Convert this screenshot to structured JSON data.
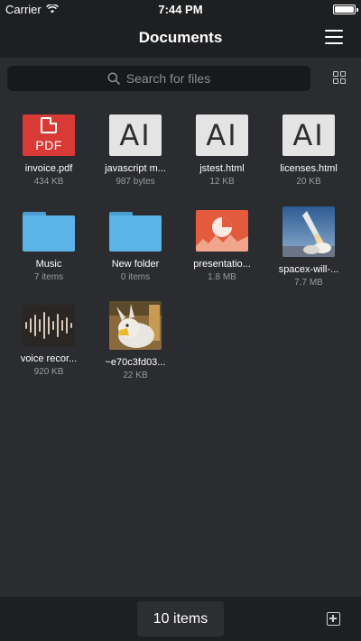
{
  "status": {
    "carrier": "Carrier",
    "time": "7:44 PM"
  },
  "nav": {
    "title": "Documents",
    "menu_icon": "hamburger-icon"
  },
  "search": {
    "placeholder": "Search for files",
    "view_icon": "grid-view-icon"
  },
  "files": [
    {
      "name": "invoice.pdf",
      "meta": "434 KB",
      "kind": "pdf",
      "badge": "PDF"
    },
    {
      "name": "javascript m...",
      "meta": "987 bytes",
      "kind": "ai",
      "badge": "AI"
    },
    {
      "name": "jstest.html",
      "meta": "12 KB",
      "kind": "ai",
      "badge": "AI"
    },
    {
      "name": "licenses.html",
      "meta": "20 KB",
      "kind": "ai",
      "badge": "AI"
    },
    {
      "name": "Music",
      "meta": "7 items",
      "kind": "folder"
    },
    {
      "name": "New folder",
      "meta": "0 items",
      "kind": "folder"
    },
    {
      "name": "presentatio...",
      "meta": "1.8 MB",
      "kind": "presentation"
    },
    {
      "name": "spacex-will-...",
      "meta": "7.7 MB",
      "kind": "photo-rocket"
    },
    {
      "name": "voice recor...",
      "meta": "920 KB",
      "kind": "audio"
    },
    {
      "name": "~e70c3fd03...",
      "meta": "22 KB",
      "kind": "photo-bunny"
    }
  ],
  "footer": {
    "count": "10 items",
    "add_icon": "add-file-icon"
  },
  "colors": {
    "background": "#2b2c2f",
    "bar": "#1e1f21",
    "pdf": "#d83a36",
    "folder": "#5bb3e6"
  }
}
